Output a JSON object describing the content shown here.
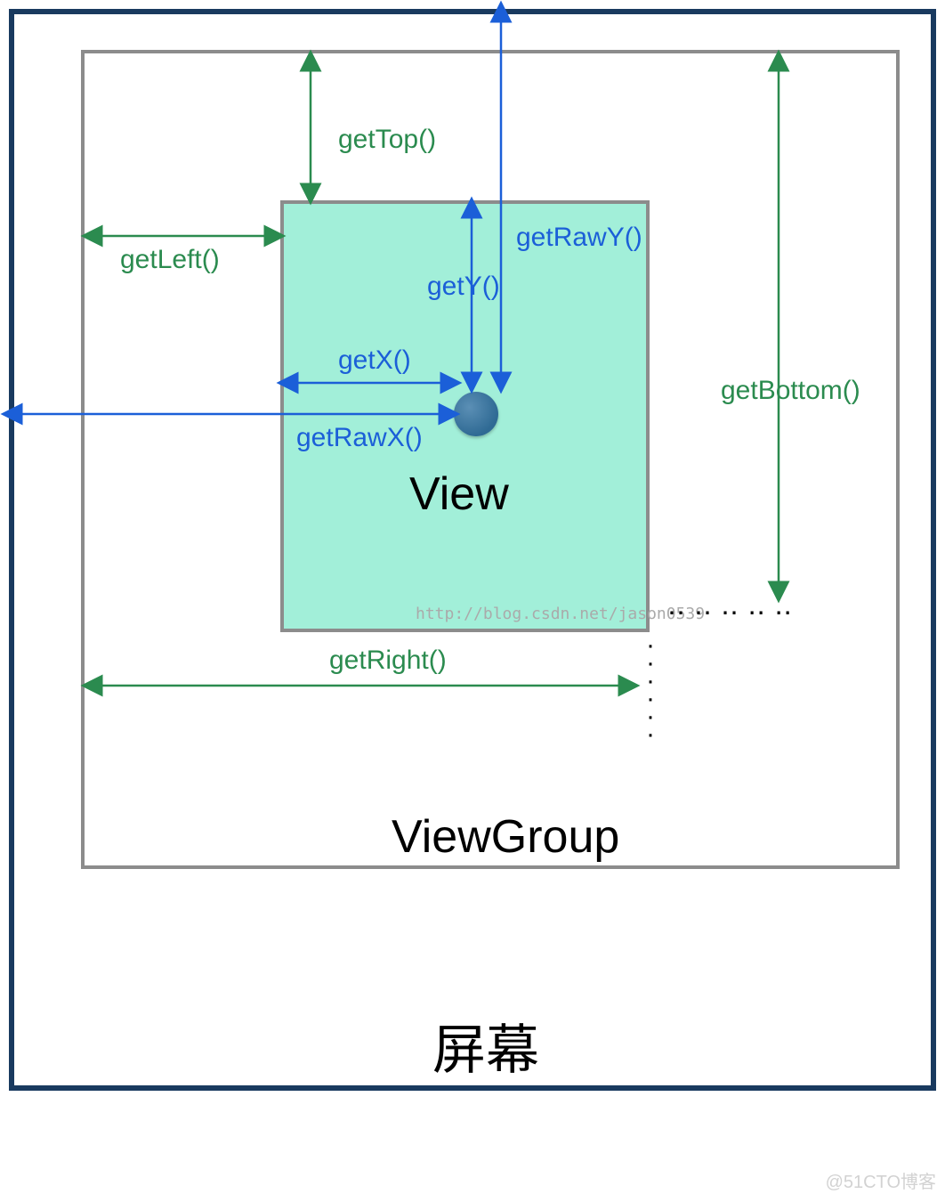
{
  "labels": {
    "getTop": "getTop()",
    "getLeft": "getLeft()",
    "getRawY": "getRawY()",
    "getY": "getY()",
    "getX": "getX()",
    "getRawX": "getRawX()",
    "getBottom": "getBottom()",
    "getRight": "getRight()",
    "view": "View",
    "viewGroup": "ViewGroup",
    "screen": "屏幕",
    "watermark": "http://blog.csdn.net/jason0539",
    "cornerMark": "@51CTO博客"
  },
  "colors": {
    "screenBorder": "#193a5f",
    "groupBorder": "#8c8c8c",
    "viewFill": "#a2efd9",
    "dotFill": "#2f6a94",
    "greenText": "#2b8b4f",
    "blueText": "#1b5fd8"
  }
}
